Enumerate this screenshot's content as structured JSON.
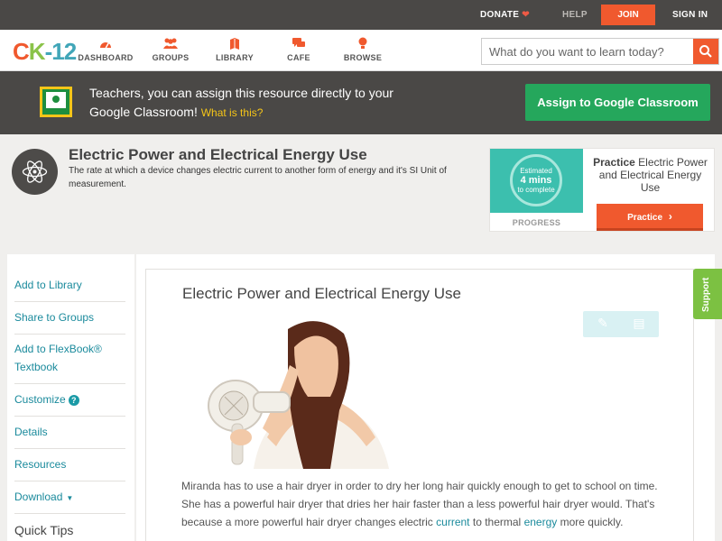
{
  "topbar": {
    "donate": "DONATE",
    "help": "HELP",
    "join": "JOIN",
    "signin": "SIGN IN"
  },
  "nav": {
    "logo": {
      "c": "C",
      "k": "K",
      "dash": "-",
      "num": "12"
    },
    "items": [
      {
        "label": "DASHBOARD",
        "icon": "dashboard-icon"
      },
      {
        "label": "GROUPS",
        "icon": "groups-icon"
      },
      {
        "label": "LIBRARY",
        "icon": "library-icon"
      },
      {
        "label": "CAFE",
        "icon": "cafe-icon"
      },
      {
        "label": "BROWSE",
        "icon": "browse-icon"
      }
    ],
    "search_placeholder": "What do you want to learn today?"
  },
  "banner": {
    "text": "Teachers, you can assign this resource directly to your Google Classroom!",
    "what_is_this": "What is this?",
    "assign_button": "Assign to Google Classroom"
  },
  "concept": {
    "title": "Electric Power and Electrical Energy Use",
    "description": "The rate at which a device changes electric current to another form of energy and it's SI Unit of measurement."
  },
  "practice": {
    "estimated": "Estimated",
    "mins": "4 mins",
    "to_complete": "to complete",
    "progress_label": "PROGRESS",
    "title_bold": "Practice",
    "title_rest": "Electric Power and Electrical Energy Use",
    "button": "Practice"
  },
  "sidebar": {
    "items": [
      {
        "label": "Add to Library"
      },
      {
        "label": "Share to Groups"
      },
      {
        "label": "Add to FlexBook® Textbook"
      },
      {
        "label": "Customize"
      },
      {
        "label": "Details"
      },
      {
        "label": "Resources"
      },
      {
        "label": "Download"
      }
    ],
    "quick_tips": "Quick Tips"
  },
  "article": {
    "title": "Electric Power and Electrical Energy Use",
    "text_1": "Miranda has to use a hair dryer in order to dry her long hair quickly enough to get to school on time. She has a powerful hair dryer that dries her hair faster than a less powerful hair dryer would. That's because a more powerful hair dryer changes electric",
    "link_current": "current",
    "text_2": "to thermal",
    "link_energy": "energy",
    "text_3": "more quickly."
  },
  "support": "Support",
  "colors": {
    "accent": "#f0592e",
    "dark_bar": "#4a4846",
    "link": "#1a8a9c",
    "green": "#25a75c",
    "support": "#7cc142"
  }
}
